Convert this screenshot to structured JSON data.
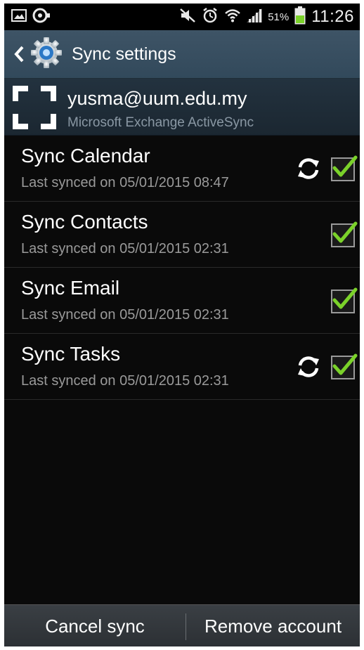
{
  "status_bar": {
    "icons": [
      "gallery-icon",
      "voice-recorder-icon",
      "mute-icon",
      "alarm-icon",
      "wifi-icon",
      "signal-icon",
      "battery-icon"
    ],
    "battery_percent": "51%",
    "battery_level": 0.51,
    "time": "11:26"
  },
  "header": {
    "title": "Sync settings",
    "icons": [
      "back-arrow-icon",
      "settings-gear-icon"
    ]
  },
  "account": {
    "email": "yusma@uum.edu.my",
    "type": "Microsoft Exchange ActiveSync",
    "icon": "exchange-account-icon"
  },
  "sync_items": [
    {
      "label": "Sync Calendar",
      "last_synced": "Last synced on 05/01/2015 08:47",
      "checked": true,
      "syncing": true
    },
    {
      "label": "Sync Contacts",
      "last_synced": "Last synced on 05/01/2015 02:31",
      "checked": true,
      "syncing": false
    },
    {
      "label": "Sync Email",
      "last_synced": "Last synced on 05/01/2015 02:31",
      "checked": true,
      "syncing": false
    },
    {
      "label": "Sync Tasks",
      "last_synced": "Last synced on 05/01/2015 02:31",
      "checked": true,
      "syncing": true
    }
  ],
  "bottom_bar": {
    "cancel_label": "Cancel sync",
    "remove_label": "Remove account"
  },
  "colors": {
    "action_bar": "#3e5466",
    "checkmark": "#7bd22a",
    "battery_fill": "#7bd22a"
  }
}
